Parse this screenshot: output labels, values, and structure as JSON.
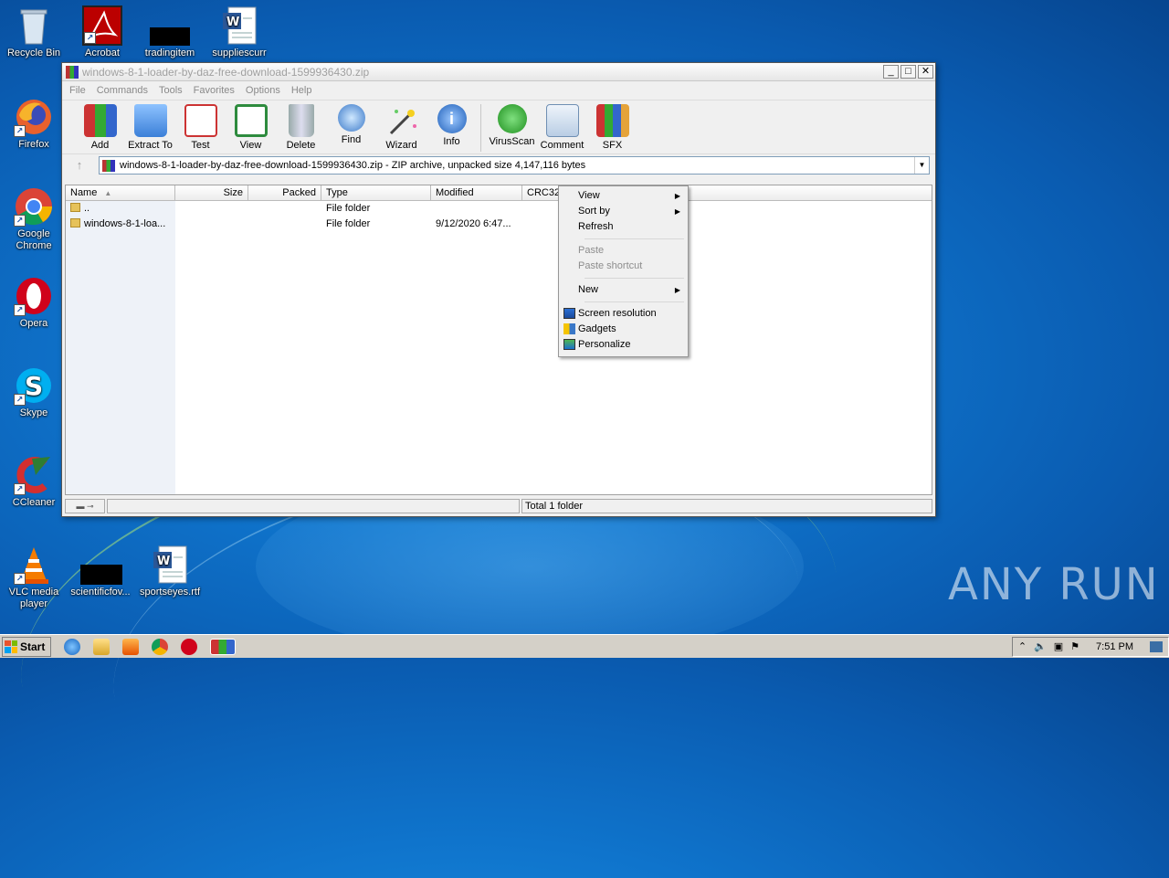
{
  "desktop": {
    "icons": [
      {
        "label": "Recycle Bin"
      },
      {
        "label": "Acrobat"
      },
      {
        "label": "tradingitem"
      },
      {
        "label": "suppliescurr"
      },
      {
        "label": "Firefox"
      },
      {
        "label": "Google Chrome"
      },
      {
        "label": "Opera"
      },
      {
        "label": "Skype"
      },
      {
        "label": "CCleaner"
      },
      {
        "label": "VLC media player"
      },
      {
        "label": "scientificfov..."
      },
      {
        "label": "sportseyes.rtf"
      }
    ],
    "watermark": "ANY RUN"
  },
  "window": {
    "title": "windows-8-1-loader-by-daz-free-download-1599936430.zip",
    "controls": {
      "minimize": "_",
      "maximize": "□",
      "close": "✕"
    },
    "menu": [
      "File",
      "Commands",
      "Tools",
      "Favorites",
      "Options",
      "Help"
    ],
    "toolbar": [
      "Add",
      "Extract To",
      "Test",
      "View",
      "Delete",
      "Find",
      "Wizard",
      "Info",
      "VirusScan",
      "Comment",
      "SFX"
    ],
    "address": "windows-8-1-loader-by-daz-free-download-1599936430.zip - ZIP archive, unpacked size 4,147,116 bytes",
    "columns": {
      "name": "Name",
      "size": "Size",
      "packed": "Packed",
      "type": "Type",
      "modified": "Modified",
      "crc": "CRC32"
    },
    "rows": [
      {
        "name": "..",
        "size": "",
        "packed": "",
        "type": "File folder",
        "modified": ""
      },
      {
        "name": "windows-8-1-loa...",
        "size": "",
        "packed": "",
        "type": "File folder",
        "modified": "9/12/2020 6:47..."
      }
    ],
    "status": {
      "total": "Total 1 folder"
    }
  },
  "context_menu": {
    "view": "View",
    "sort_by": "Sort by",
    "refresh": "Refresh",
    "paste": "Paste",
    "paste_shortcut": "Paste shortcut",
    "new": "New",
    "screen_resolution": "Screen resolution",
    "gadgets": "Gadgets",
    "personalize": "Personalize"
  },
  "taskbar": {
    "start": "Start",
    "clock": "7:51 PM"
  }
}
